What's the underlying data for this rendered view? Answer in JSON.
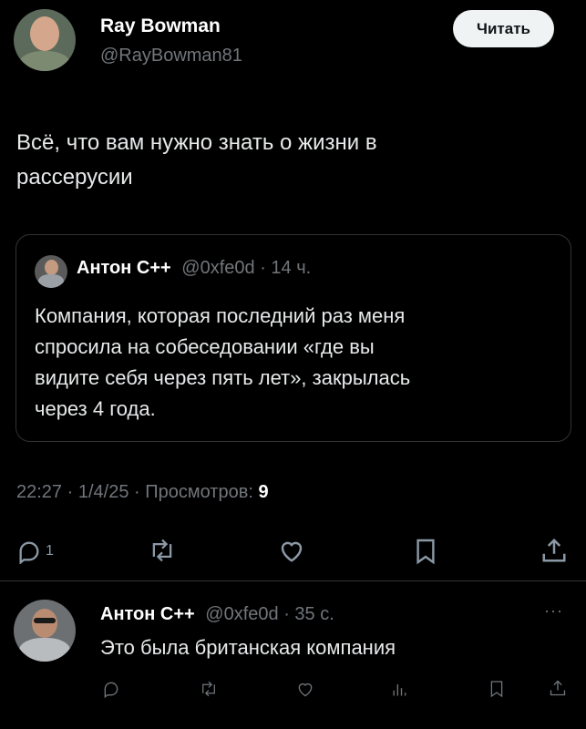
{
  "tweet": {
    "author_name": "Ray Bowman",
    "author_handle": "@RayBowman81",
    "follow_label": "Читать",
    "text_line1": "Всё, что вам нужно знать о жизни в",
    "text_line2": "рассерусии",
    "time": "22:27",
    "date": "1/4/25",
    "views_label": "Просмотров:",
    "views_count": "9",
    "reply_count": "1"
  },
  "quote": {
    "author_name": "Антон С++",
    "author_handle": "@0xfe0d",
    "age": "14 ч.",
    "text_lines": [
      "Компания, которая последний раз меня",
      "спросила на собеседовании «где вы",
      "видите себя через пять лет», закрылась",
      "через 4 года."
    ]
  },
  "reply": {
    "author_name": "Антон С++",
    "author_handle": "@0xfe0d",
    "age": "35 с.",
    "text": "Это была британская компания",
    "more": "···"
  },
  "icons": {
    "reply": "reply-icon",
    "retweet": "retweet-icon",
    "like": "heart-icon",
    "bookmark": "bookmark-icon",
    "share": "share-icon",
    "views": "views-icon"
  }
}
